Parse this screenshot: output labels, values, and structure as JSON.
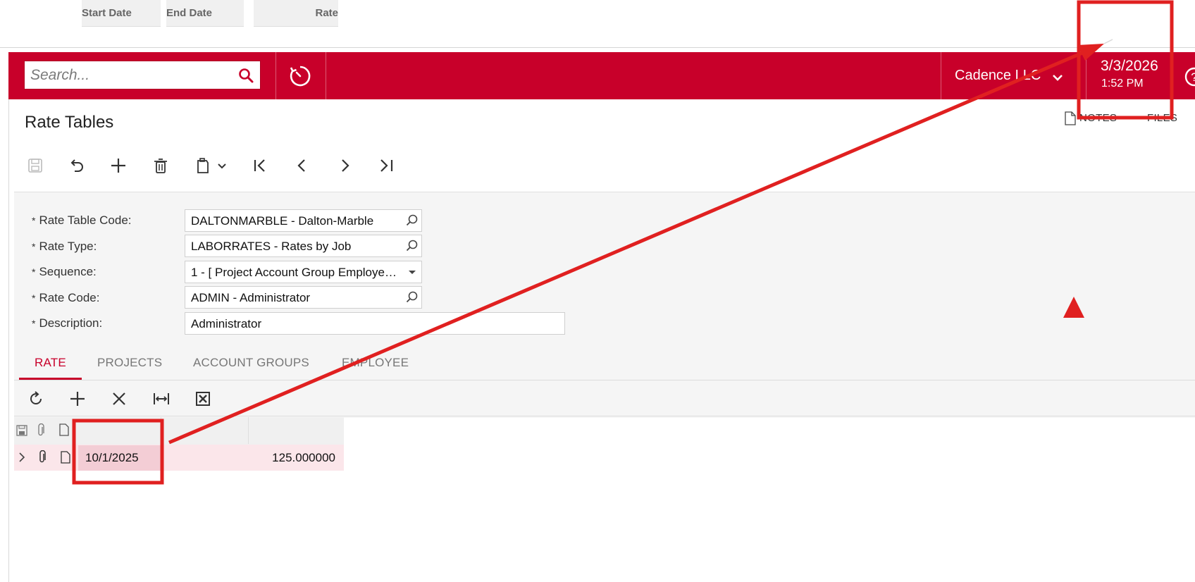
{
  "header": {
    "search_placeholder": "Search...",
    "company": "Cadence LLC",
    "date": "3/3/2026",
    "time": "1:52 PM"
  },
  "page": {
    "title": "Rate Tables",
    "notes_label": "NOTES",
    "files_label": "FILES"
  },
  "form": {
    "rate_table_code": {
      "label": "Rate Table Code:",
      "value": "DALTONMARBLE - Dalton-Marble"
    },
    "rate_type": {
      "label": "Rate Type:",
      "value": "LABORRATES - Rates by Job"
    },
    "sequence": {
      "label": "Sequence:",
      "value": "1 - [ Project Account Group Employe…"
    },
    "rate_code": {
      "label": "Rate Code:",
      "value": "ADMIN - Administrator"
    },
    "description": {
      "label": "Description:",
      "value": "Administrator"
    },
    "required_marker": "*"
  },
  "tabs": [
    "RATE",
    "PROJECTS",
    "ACCOUNT GROUPS",
    "EMPLOYEE"
  ],
  "active_tab": "RATE",
  "grid": {
    "columns": [
      "Start Date",
      "End Date",
      "Rate"
    ],
    "rows": [
      {
        "start_date": "10/1/2025",
        "end_date": "",
        "rate": "125.000000"
      }
    ]
  },
  "colors": {
    "brand": "#c8002a",
    "annotation": "#e02020",
    "selected_row": "#fbe6ea"
  }
}
